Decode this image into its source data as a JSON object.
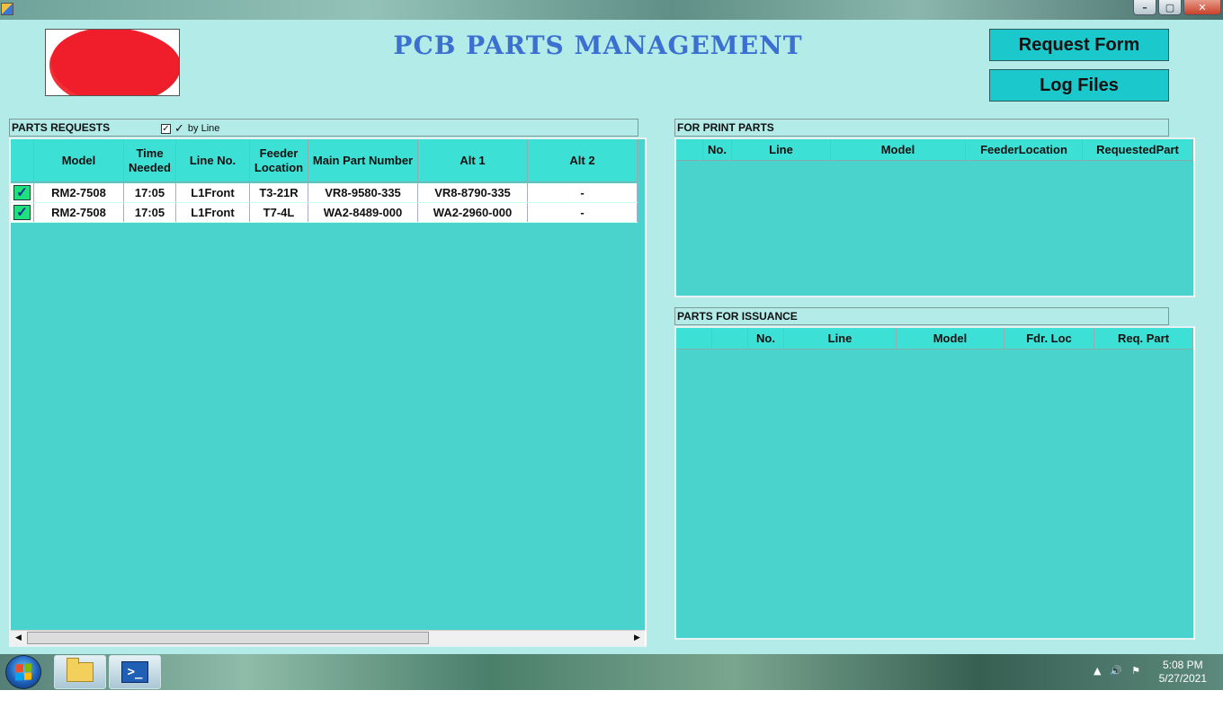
{
  "window": {
    "minimize": "–",
    "maximize": "▢",
    "close": "✕"
  },
  "title": "PCB PARTS MANAGEMENT",
  "buttons": {
    "request_form": "Request Form",
    "log_files": "Log Files"
  },
  "parts_requests": {
    "caption": "PARTS REQUESTS",
    "by_line_checked": true,
    "by_line_label": "by Line",
    "columns": [
      "",
      "Model",
      "Time Needed",
      "Line No.",
      "Feeder Location",
      "Main Part Number",
      "Alt 1",
      "Alt 2"
    ],
    "rows": [
      {
        "checked": true,
        "model": "RM2-7508",
        "time": "17:05",
        "line": "L1Front",
        "feeder": "T3-21R",
        "main_part": "VR8-9580-335",
        "alt1": "VR8-8790-335",
        "alt2": "-"
      },
      {
        "checked": true,
        "model": "RM2-7508",
        "time": "17:05",
        "line": "L1Front",
        "feeder": "T7-4L",
        "main_part": "WA2-8489-000",
        "alt1": "WA2-2960-000",
        "alt2": "-"
      }
    ]
  },
  "for_print_parts": {
    "caption": "FOR PRINT PARTS",
    "columns": [
      "",
      "No.",
      "Line",
      "Model",
      "FeederLocation",
      "RequestedPart"
    ]
  },
  "parts_for_issuance": {
    "caption": "PARTS FOR ISSUANCE",
    "columns": [
      "",
      "",
      "No.",
      "Line",
      "Model",
      "Fdr. Loc",
      "Req. Part"
    ]
  },
  "taskbar": {
    "time": "5:08 PM",
    "date": "5/27/2021"
  },
  "colors": {
    "form_bg": "#b2ebe8",
    "grid_bg": "#4ad2cc",
    "header_bg": "#3de0d4",
    "button_bg": "#1bc9cc",
    "title": "#3b6fd0",
    "check_bg": "#1ee07d"
  }
}
